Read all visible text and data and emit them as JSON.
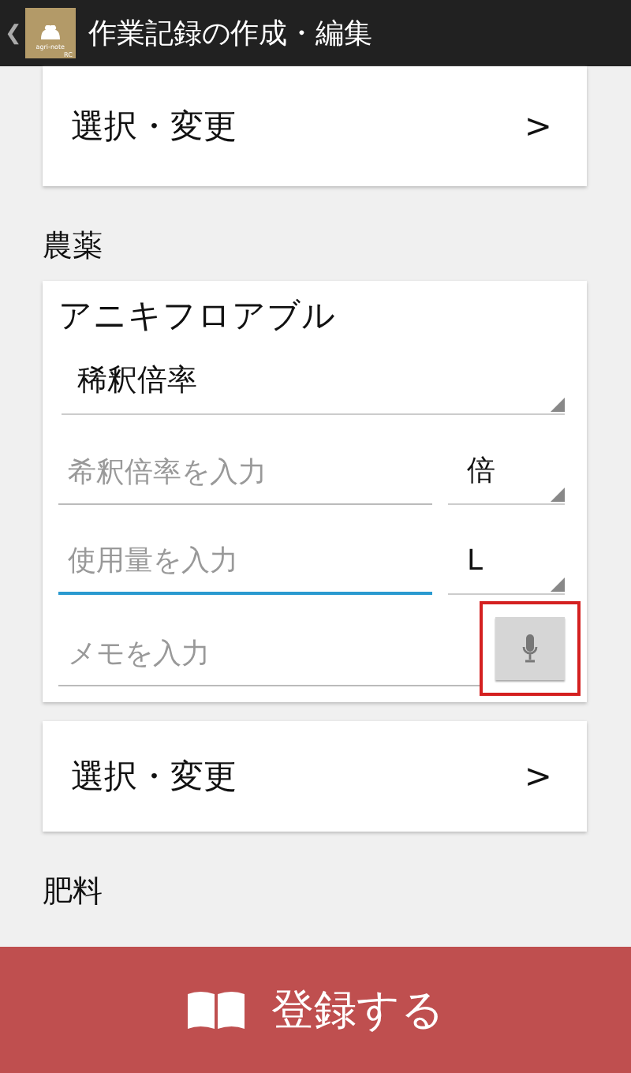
{
  "app_bar": {
    "back": "❮",
    "logo": {
      "name": "agri-note",
      "badge": "RC"
    },
    "title": "作業記録の作成・編集"
  },
  "top_select": {
    "label": "選択・変更",
    "chevron": ">"
  },
  "sections": [
    {
      "heading": "農薬",
      "item": {
        "name": "アニキフロアブル",
        "dropdown": {
          "value": "稀釈倍率"
        },
        "rows": [
          {
            "kind": "input_unit",
            "placeholder": "希釈倍率を入力",
            "focused": false,
            "unit": "倍"
          },
          {
            "kind": "input_unit",
            "placeholder": "使用量を入力",
            "focused": true,
            "unit": "L"
          },
          {
            "kind": "memo",
            "placeholder": "メモを入力",
            "highlighted": true
          }
        ]
      },
      "select": {
        "label": "選択・変更",
        "chevron": ">"
      }
    },
    {
      "heading": "肥料"
    }
  ],
  "submit": {
    "label": "登録する"
  }
}
